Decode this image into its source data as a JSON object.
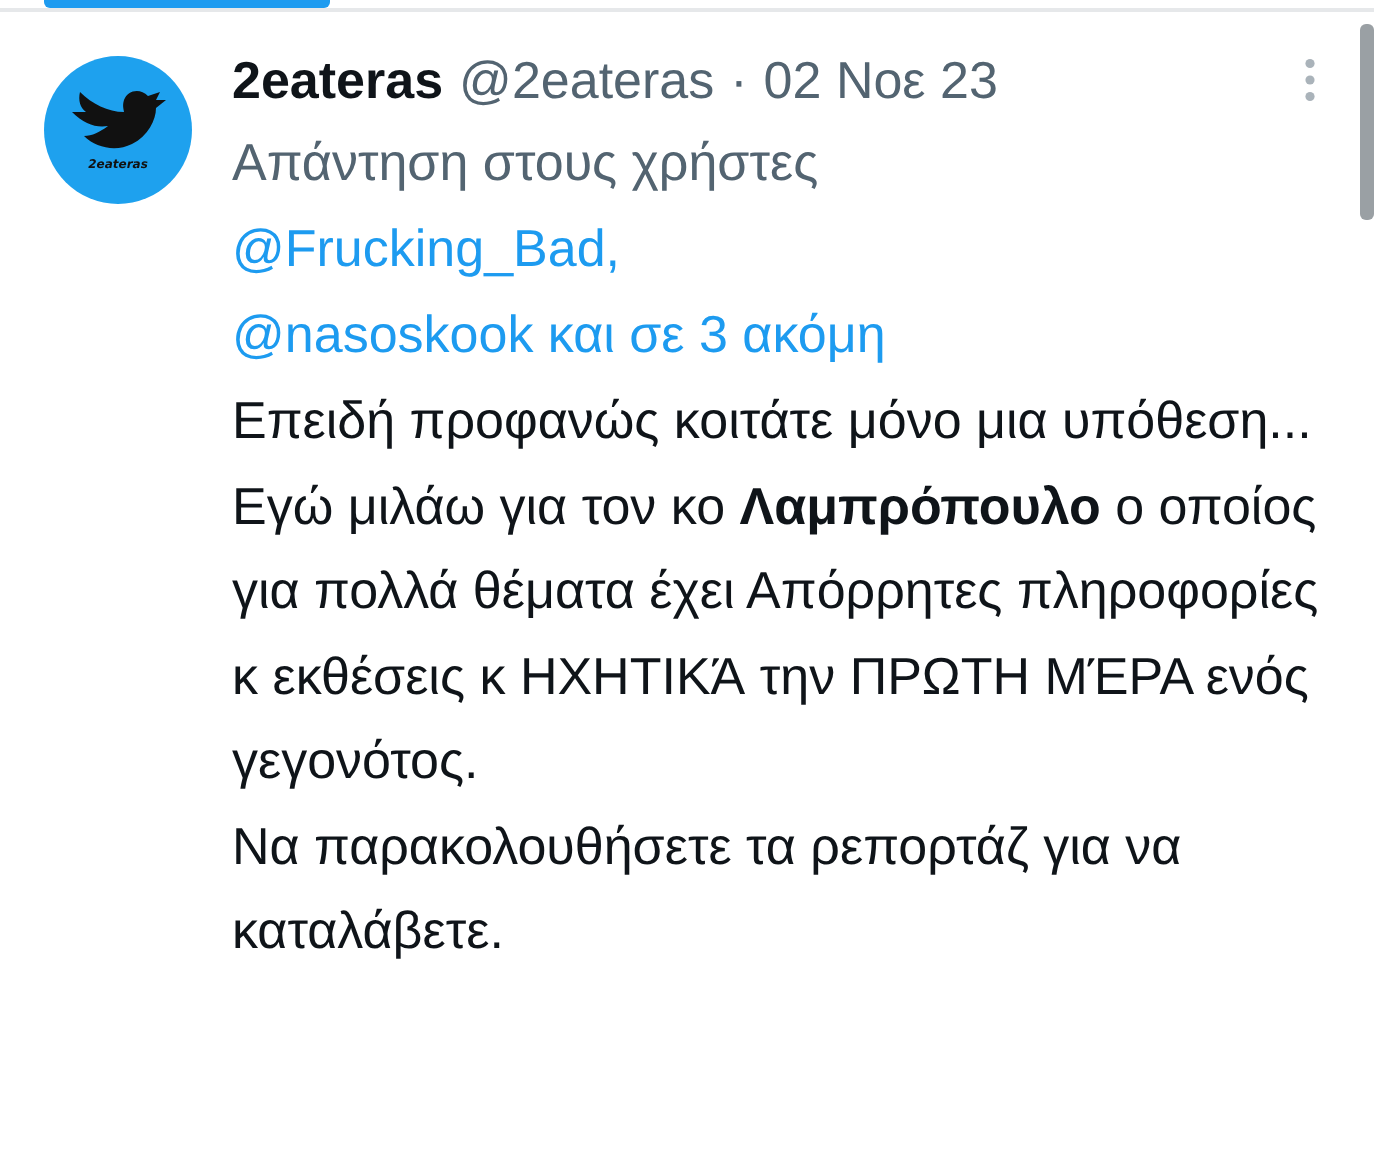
{
  "tweet": {
    "author": {
      "name": "2eateras",
      "handle": "@2eateras",
      "avatar_caption": "2eateras"
    },
    "separator": "·",
    "date": "02 Νοε 23",
    "reply_to": {
      "prefix": "Απάντηση στους χρήστες",
      "mentions": [
        "@Frucking_Bad,",
        "@nasoskook και σε 3 ακόμη"
      ]
    },
    "paragraphs": [
      "Επειδή προφανώς κοιτάτε μόνο μια υπόθεση...",
      "Εγώ μιλάω για τον κο **Λαμπρόπουλο** ο οποίος για πολλά θέματα έχει Απόρρητες πληροφορίες κ εκθέσεις κ ΗΧΗΤΙΚΆ την ΠΡΩΤΗ ΜΈΡΑ ενός γεγονότος.",
      "Να παρακολουθήσετε τα ρεπορτάζ για να καταλάβετε."
    ]
  }
}
